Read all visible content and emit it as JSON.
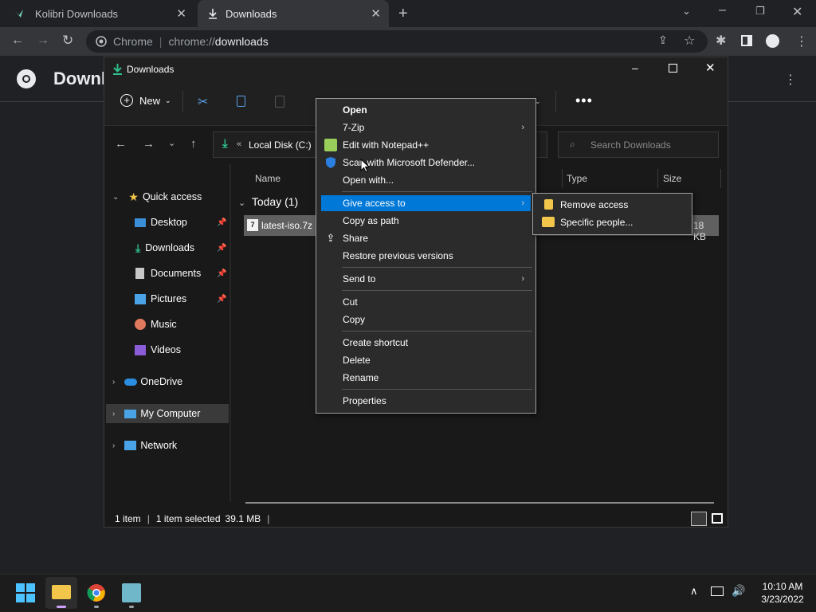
{
  "browser": {
    "tabs": [
      {
        "label": "Kolibri Downloads"
      },
      {
        "label": "Downloads"
      }
    ],
    "omnibox": {
      "host": "Chrome",
      "path_scheme": "chrome://",
      "path": "downloads"
    },
    "page_title": "Downloads"
  },
  "explorer": {
    "window_title": "Downloads",
    "new_label": "New",
    "address": {
      "prefix": "«",
      "location": "Local Disk (C:)"
    },
    "search_placeholder": "Search Downloads",
    "nav": {
      "quick_access": "Quick access",
      "items": [
        {
          "label": "Desktop"
        },
        {
          "label": "Downloads"
        },
        {
          "label": "Documents"
        },
        {
          "label": "Pictures"
        },
        {
          "label": "Music"
        },
        {
          "label": "Videos"
        }
      ],
      "onedrive": "OneDrive",
      "my_computer": "My Computer",
      "network": "Network"
    },
    "columns": {
      "name": "Name",
      "type": "Type",
      "size": "Size"
    },
    "group": "Today (1)",
    "file": {
      "name": "latest-iso.7z",
      "size": "18 KB"
    },
    "status": {
      "count": "1 item",
      "selected": "1 item selected",
      "size": "39.1 MB"
    }
  },
  "context_menu": {
    "items": [
      {
        "label": "Open"
      },
      {
        "label": "7-Zip"
      },
      {
        "label": "Edit with Notepad++"
      },
      {
        "label": "Scan with Microsoft Defender..."
      },
      {
        "label": "Open with..."
      },
      {
        "label": "Give access to"
      },
      {
        "label": "Copy as path"
      },
      {
        "label": "Share"
      },
      {
        "label": "Restore previous versions"
      },
      {
        "label": "Send to"
      },
      {
        "label": "Cut"
      },
      {
        "label": "Copy"
      },
      {
        "label": "Create shortcut"
      },
      {
        "label": "Delete"
      },
      {
        "label": "Rename"
      },
      {
        "label": "Properties"
      }
    ],
    "submenu": [
      {
        "label": "Remove access"
      },
      {
        "label": "Specific people..."
      }
    ]
  },
  "taskbar": {
    "time": "10:10 AM",
    "date": "3/23/2022"
  },
  "colors": {
    "accent": "#0078d7",
    "folder": "#f2c54b",
    "chrome_bar": "#35363a"
  }
}
